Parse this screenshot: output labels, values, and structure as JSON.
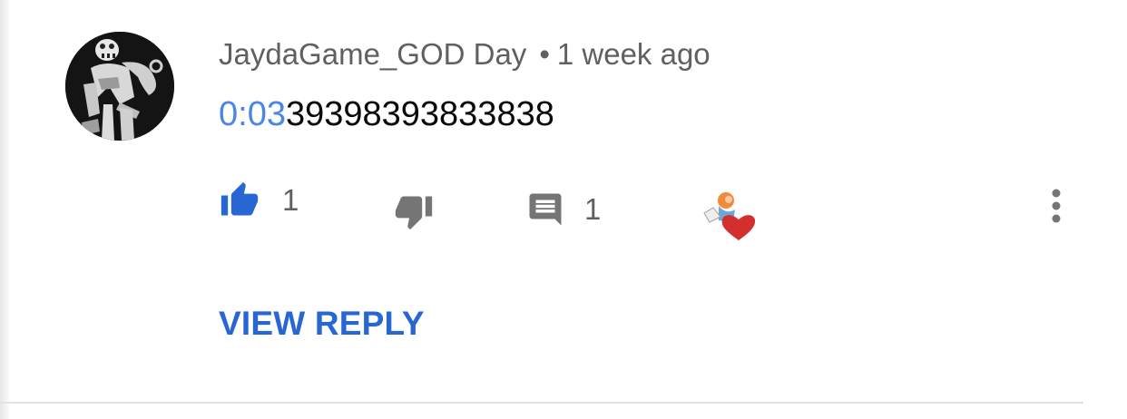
{
  "comment": {
    "author": "JaydaGame_GOD Day",
    "separator": "•",
    "time": "1 week ago",
    "timestamp_link": "0:03",
    "text_after": "39398393833838"
  },
  "actions": {
    "like_count": "1",
    "reply_count": "1",
    "icons": [
      "thumbs-up-icon",
      "thumbs-down-icon",
      "reply-icon",
      "creator-heart-icon",
      "more-vert-icon"
    ]
  },
  "view_reply_label": "VIEW REPLY",
  "colors": {
    "like_active": "#2866d4",
    "timestamp_link": "#4a86e8",
    "meta_text": "#606060",
    "icon_gray": "#757575",
    "heart": "#d32f2f"
  }
}
